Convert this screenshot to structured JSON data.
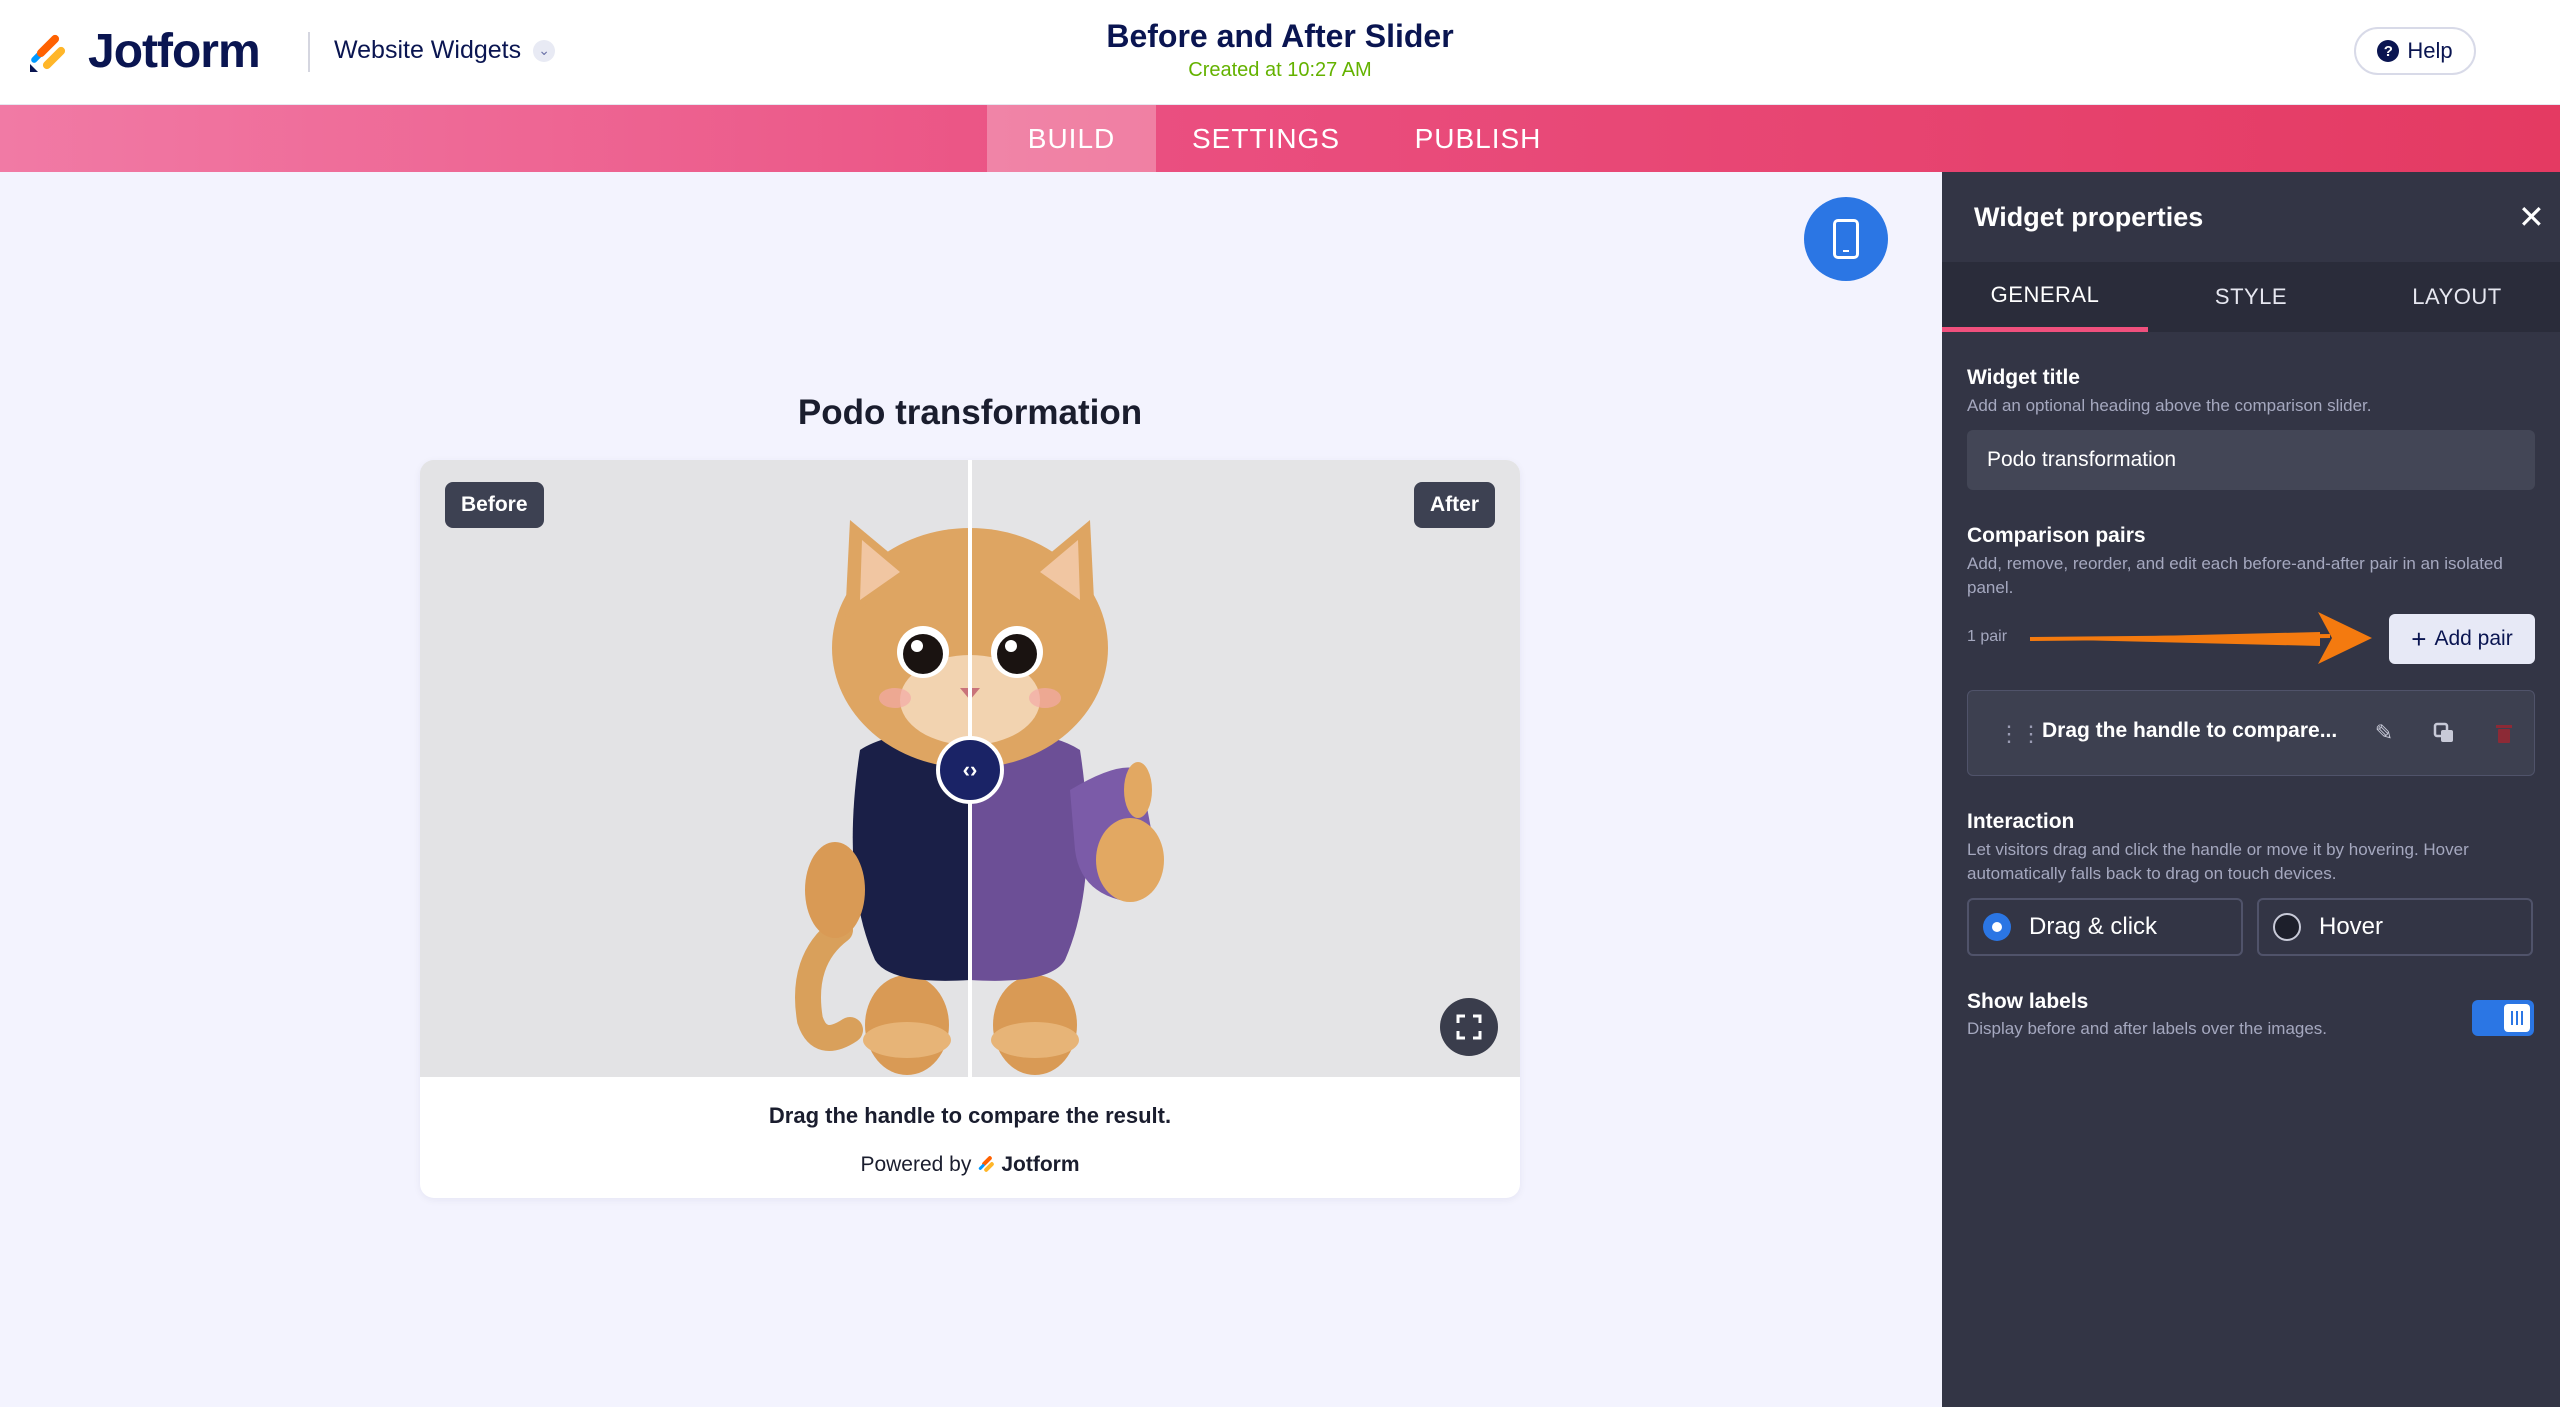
{
  "header": {
    "logo_text": "Jotform",
    "workspace": "Website Widgets",
    "title": "Before and After Slider",
    "subtitle": "Created at 10:27 AM",
    "help_label": "Help"
  },
  "nav": {
    "tabs": [
      {
        "label": "BUILD",
        "active": true
      },
      {
        "label": "SETTINGS",
        "active": false
      },
      {
        "label": "PUBLISH",
        "active": false
      }
    ]
  },
  "preview": {
    "widget_title": "Podo transformation",
    "before_label": "Before",
    "after_label": "After",
    "caption": "Drag the handle to compare the result.",
    "powered_prefix": "Powered by",
    "powered_brand": "Jotform",
    "handle_position_percent": 50
  },
  "panel": {
    "title": "Widget properties",
    "tabs": [
      {
        "label": "GENERAL",
        "active": true
      },
      {
        "label": "STYLE",
        "active": false
      },
      {
        "label": "LAYOUT",
        "active": false
      }
    ],
    "widget_title": {
      "label": "Widget title",
      "desc": "Add an optional heading above the comparison slider.",
      "value": "Podo transformation"
    },
    "pairs": {
      "label": "Comparison pairs",
      "desc": "Add, remove, reorder, and edit each before-and-after pair in an isolated panel.",
      "count": "1 pair",
      "add_label": "Add pair",
      "items": [
        {
          "label": "Drag the handle to compare..."
        }
      ]
    },
    "interaction": {
      "label": "Interaction",
      "desc": "Let visitors drag and click the handle or move it by hovering. Hover automatically falls back to drag on touch devices.",
      "options": [
        {
          "label": "Drag & click",
          "selected": true
        },
        {
          "label": "Hover",
          "selected": false
        }
      ]
    },
    "show_labels": {
      "label": "Show labels",
      "desc": "Display before and after labels over the images.",
      "on": true
    }
  },
  "colors": {
    "accent_blue": "#2b76e4",
    "nav_pink": "#ea4f80",
    "annotation_orange": "#f47a0f",
    "panel_bg": "#333545"
  }
}
